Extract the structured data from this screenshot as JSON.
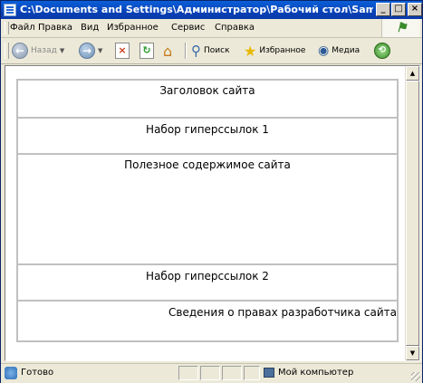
{
  "window": {
    "title": "C:\\Documents and Settings\\Администратор\\Рабочий стол\\Samples\\frame.ht...",
    "minimize": "_",
    "maximize": "□",
    "close": "×"
  },
  "menu": {
    "items": [
      "Файл",
      "Правка",
      "Вид",
      "Избранное",
      "Сервис",
      "Справка"
    ]
  },
  "toolbar": {
    "back_label": "Назад",
    "search_label": "Поиск",
    "favorites_label": "Избранное",
    "media_label": "Медиа"
  },
  "frames": [
    "Заголовок сайта",
    "Набор гиперссылок 1",
    "Полезное содержимое сайта",
    "Набор гиперссылок 2",
    "Сведения о правах разработчика сайта"
  ],
  "status": {
    "text": "Готово",
    "zone": "Мой компьютер"
  }
}
